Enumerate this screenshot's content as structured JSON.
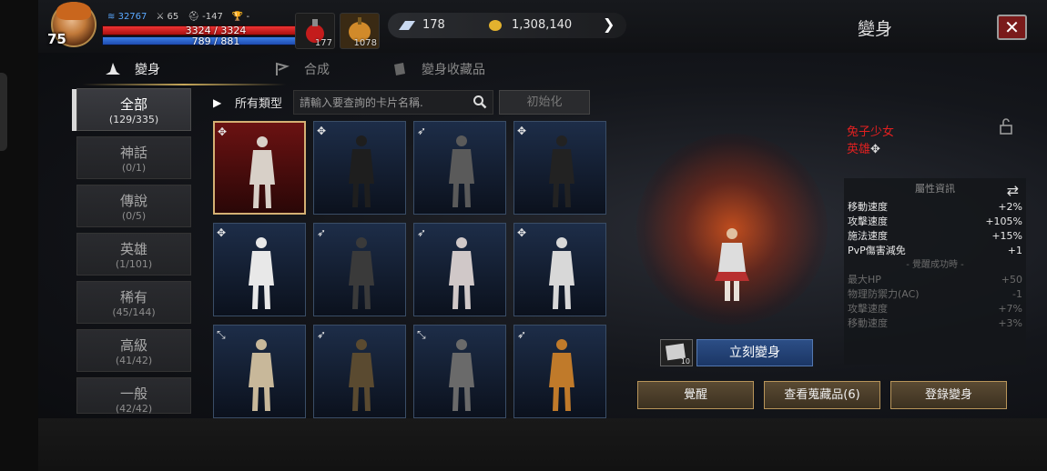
{
  "player": {
    "level": "75",
    "stat_power": "32767",
    "stat_attack": "65",
    "stat_defense": "-147",
    "stat_trophy": "-",
    "hp_text": "3324 / 3324",
    "hp_fraction": 1.0,
    "mp_text": "789 / 881",
    "mp_fraction": 0.895
  },
  "potions": [
    {
      "qty": "177",
      "icon": "red-potion-icon"
    },
    {
      "qty": "1078",
      "icon": "gold-potion-icon"
    }
  ],
  "currency": {
    "diamond": "178",
    "gold": "1,308,140"
  },
  "window": {
    "title": "變身",
    "close_symbol": "✕"
  },
  "tabs": [
    {
      "label": "變身",
      "active": true,
      "icon": "wizard-hat-icon"
    },
    {
      "label": "合成",
      "active": false,
      "icon": "flag-icon"
    },
    {
      "label": "變身收藏品",
      "active": false,
      "icon": "book-icon"
    }
  ],
  "categories": [
    {
      "name": "全部",
      "count": "(129/335)",
      "active": true
    },
    {
      "name": "神話",
      "count": "(0/1)",
      "active": false
    },
    {
      "name": "傳說",
      "count": "(0/5)",
      "active": false
    },
    {
      "name": "英雄",
      "count": "(1/101)",
      "active": false
    },
    {
      "name": "稀有",
      "count": "(45/144)",
      "active": false
    },
    {
      "name": "高級",
      "count": "(41/42)",
      "active": false
    },
    {
      "name": "一般",
      "count": "(42/42)",
      "active": false
    }
  ],
  "filter": {
    "type_label": "所有類型",
    "search_placeholder": "請輸入要查詢的卡片名稱.",
    "reset_label": "初始化"
  },
  "cards": [
    {
      "grade": "hero",
      "selected": true,
      "bg": "#7a1010",
      "fig": "#d8d0c8"
    },
    {
      "grade": "hero",
      "selected": false,
      "bg": "#1d2d48",
      "fig": "#1e1e1e"
    },
    {
      "grade": "rare",
      "selected": false,
      "bg": "#1d2d48",
      "fig": "#5a5a5a"
    },
    {
      "grade": "hero",
      "selected": false,
      "bg": "#1d2d48",
      "fig": "#222"
    },
    {
      "grade": "hero",
      "selected": false,
      "bg": "#1d2d48",
      "fig": "#e8e8e8"
    },
    {
      "grade": "rare",
      "selected": false,
      "bg": "#1d2d48",
      "fig": "#3a3a3a"
    },
    {
      "grade": "rare",
      "selected": false,
      "bg": "#1d2d48",
      "fig": "#d0c8c8"
    },
    {
      "grade": "hero",
      "selected": false,
      "bg": "#1d2d48",
      "fig": "#d8d8d8"
    },
    {
      "grade": "advanced",
      "selected": false,
      "bg": "#1d2d48",
      "fig": "#c8b89a"
    },
    {
      "grade": "rare",
      "selected": false,
      "bg": "#1d2d48",
      "fig": "#5a4a30"
    },
    {
      "grade": "advanced",
      "selected": false,
      "bg": "#1d2d48",
      "fig": "#6a6a6a"
    },
    {
      "grade": "rare",
      "selected": false,
      "bg": "#1d2d48",
      "fig": "#c07a2a"
    }
  ],
  "selected": {
    "name": "兔子少女",
    "grade": "英雄",
    "transform_qty": "10"
  },
  "attributes": {
    "header": "屬性資訊",
    "rows": [
      {
        "k": "移動速度",
        "v": "+2%",
        "dim": false
      },
      {
        "k": "攻擊速度",
        "v": "+105%",
        "dim": false
      },
      {
        "k": "施法速度",
        "v": "+15%",
        "dim": false
      },
      {
        "k": "PvP傷害減免",
        "v": "+1",
        "dim": false
      }
    ],
    "awaken_label": "- 覺醒成功時 -",
    "awaken_rows": [
      {
        "k": "最大HP",
        "v": "+50",
        "dim": true
      },
      {
        "k": "物理防禦力(AC)",
        "v": "-1",
        "dim": true
      },
      {
        "k": "攻擊速度",
        "v": "+7%",
        "dim": true
      },
      {
        "k": "移動速度",
        "v": "+3%",
        "dim": true
      }
    ]
  },
  "buttons": {
    "transform_now": "立刻變身",
    "awaken": "覺醒",
    "view_collection": "查看蒐藏品(6)",
    "register": "登錄變身"
  },
  "colors": {
    "accent_gold": "#b8955a",
    "selected_name_red": "#e02020",
    "transform_blue": "#2c4e86"
  }
}
